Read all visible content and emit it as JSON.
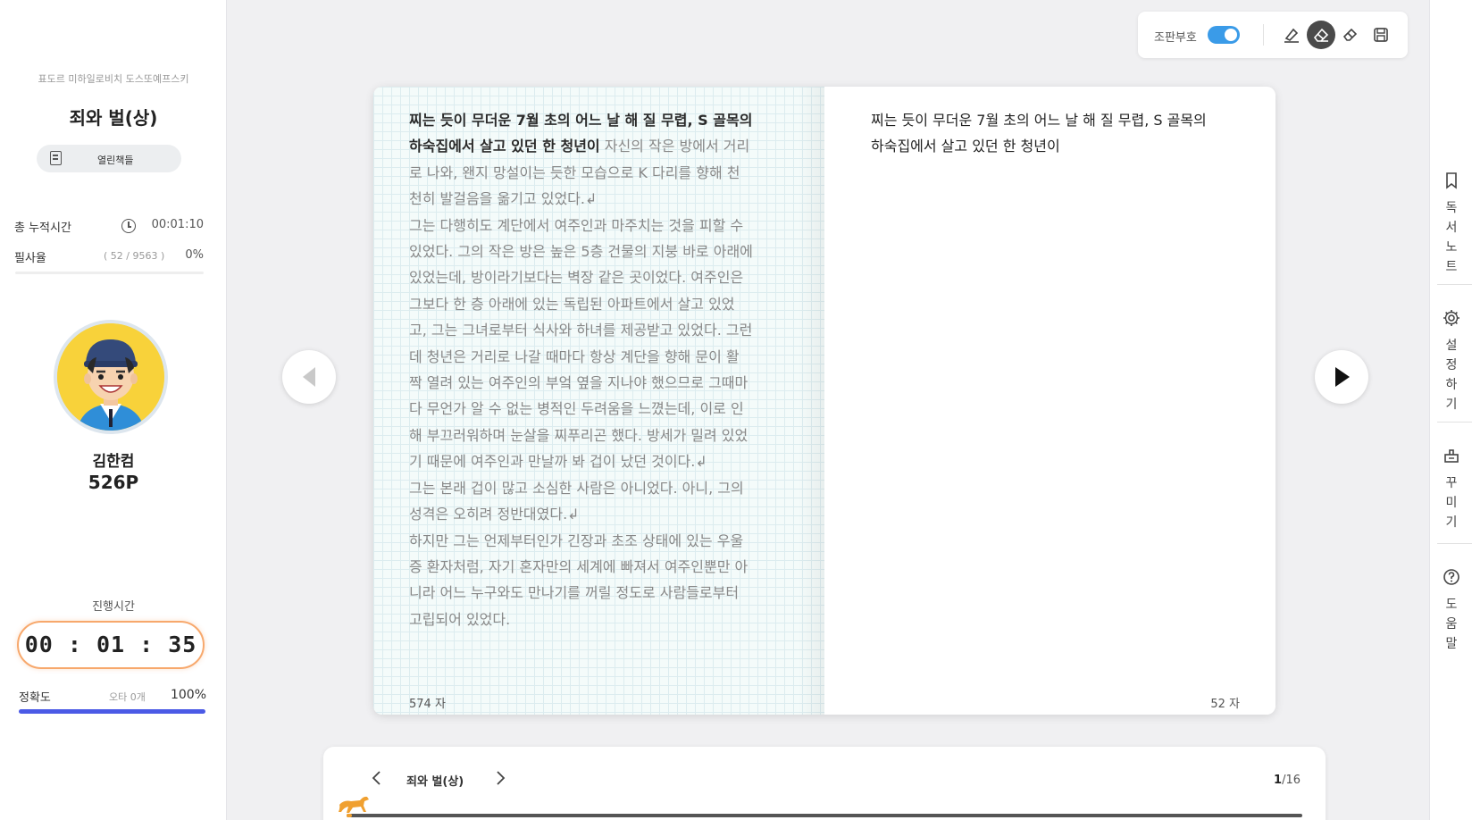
{
  "sidebar": {
    "author": "표도르 미하일로비치 도스또예프스키",
    "title": "죄와 벌(상)",
    "open_books_label": "열린책들",
    "total_time_label": "총 누적시간",
    "total_time_value": "00:01:10",
    "transcribe_label": "필사율",
    "transcribe_ratio": "( 52 / 9563 )",
    "transcribe_pct": "0%",
    "transcribe_progress": 0.005,
    "user_name": "김한컴",
    "user_points": "526P",
    "progress_time_label": "진행시간",
    "progress_time_value": "00 : 01 : 35",
    "accuracy_label": "정확도",
    "typo_label": "오타 0개",
    "accuracy_pct": "100%",
    "accuracy_progress": 1.0
  },
  "toolbar": {
    "proofmark_label": "조판부호",
    "proofmark_on": true,
    "icons": [
      "highlighter-icon",
      "eraser-icon",
      "eraser-outline-icon",
      "save-icon"
    ]
  },
  "book": {
    "reference_done": "찌는 듯이 무더운 7월 초의 어느 날 해 질 무렵, S 골목의\n하숙집에서 살고 있던 한 청년이",
    "reference_rest": " 자신의 작은 방에서 거리\n로 나와, 왠지 망설이는 듯한 모습으로 K 다리를 향해 천\n천히 발걸음을 옮기고 있었다.↲\n그는 다행히도 계단에서 여주인과 마주치는 것을 피할 수\n있었다. 그의 작은 방은 높은 5층 건물의 지붕 바로 아래에\n있었는데, 방이라기보다는 벽장 같은 곳이었다. 여주인은\n그보다 한 층 아래에 있는 독립된 아파트에서 살고 있었\n고, 그는 그녀로부터 식사와 하녀를 제공받고 있었다. 그런\n데 청년은 거리로 나갈 때마다 항상 계단을 향해 문이 활\n짝 열려 있는 여주인의 부엌 옆을 지나야 했으므로 그때마\n다 무언가 알 수 없는 병적인 두려움을 느꼈는데, 이로 인\n해 부끄러워하며 눈살을 찌푸리곤 했다. 방세가 밀려 있었\n기 때문에 여주인과 만날까 봐 겁이 났던 것이다.↲\n그는 본래 겁이 많고 소심한 사람은 아니었다. 아니, 그의\n성격은 오히려 정반대였다.↲\n하지만 그는 언제부터인가 긴장과 초조 상태에 있는 우울\n증 환자처럼, 자기 혼자만의 세계에 빠져서 여주인뿐만 아\n니라 어느 누구와도 만나기를 꺼릴 정도로 사람들로부터\n고립되어 있었다.",
    "typed_text": "찌는 듯이 무더운 7월 초의 어느 날 해 질 무렵, S 골목의\n하숙집에서 살고 있던 한 청년이",
    "left_count": "574 자",
    "right_count": "52 자"
  },
  "rail": {
    "items": [
      {
        "icon": "bookmark-icon",
        "label": "독\n서\n노\n트"
      },
      {
        "icon": "gear-icon",
        "label": "설\n정\n하\n기"
      },
      {
        "icon": "decorate-icon",
        "label": "꾸\n미\n기"
      },
      {
        "icon": "help-icon",
        "label": "도\n움\n말"
      }
    ]
  },
  "bottom": {
    "chapter_title": "죄와 벌(상)",
    "page_current": "1",
    "page_total": "/16",
    "progress": 0.005
  },
  "colors": {
    "accent_blue": "#4b5ae6",
    "toggle_blue": "#3a9be8",
    "timer_orange": "#f7a86c",
    "horse_orange": "#f0a030"
  }
}
